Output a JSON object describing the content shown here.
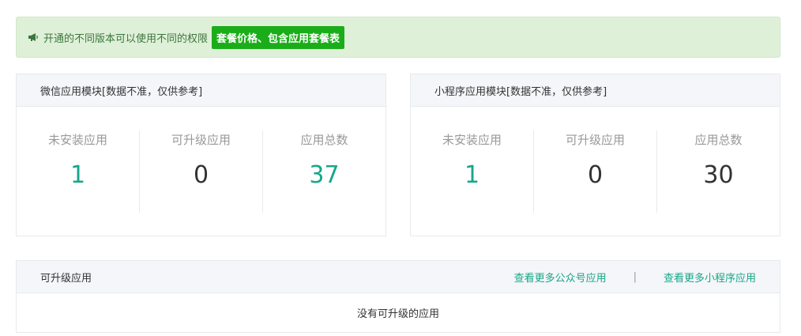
{
  "notice": {
    "text": "开通的不同版本可以使用不同的权限",
    "button_label": "套餐价格、包含应用套餐表"
  },
  "wechat_module": {
    "title": "微信应用模块[数据不准，仅供参考]",
    "stats": [
      {
        "label": "未安装应用",
        "value": "1"
      },
      {
        "label": "可升级应用",
        "value": "0"
      },
      {
        "label": "应用总数",
        "value": "37"
      }
    ]
  },
  "miniprogram_module": {
    "title": "小程序应用模块[数据不准，仅供参考]",
    "stats": [
      {
        "label": "未安装应用",
        "value": "1"
      },
      {
        "label": "可升级应用",
        "value": "0"
      },
      {
        "label": "应用总数",
        "value": "30"
      }
    ]
  },
  "upgradable": {
    "title": "可升级应用",
    "link_more_official": "查看更多公众号应用",
    "separator": "|",
    "link_more_miniprogram": "查看更多小程序应用",
    "empty_message": "没有可升级的应用"
  },
  "colors": {
    "accent_green": "#18a689",
    "button_green": "#1aad19",
    "notice_bg": "#dff0d8"
  }
}
